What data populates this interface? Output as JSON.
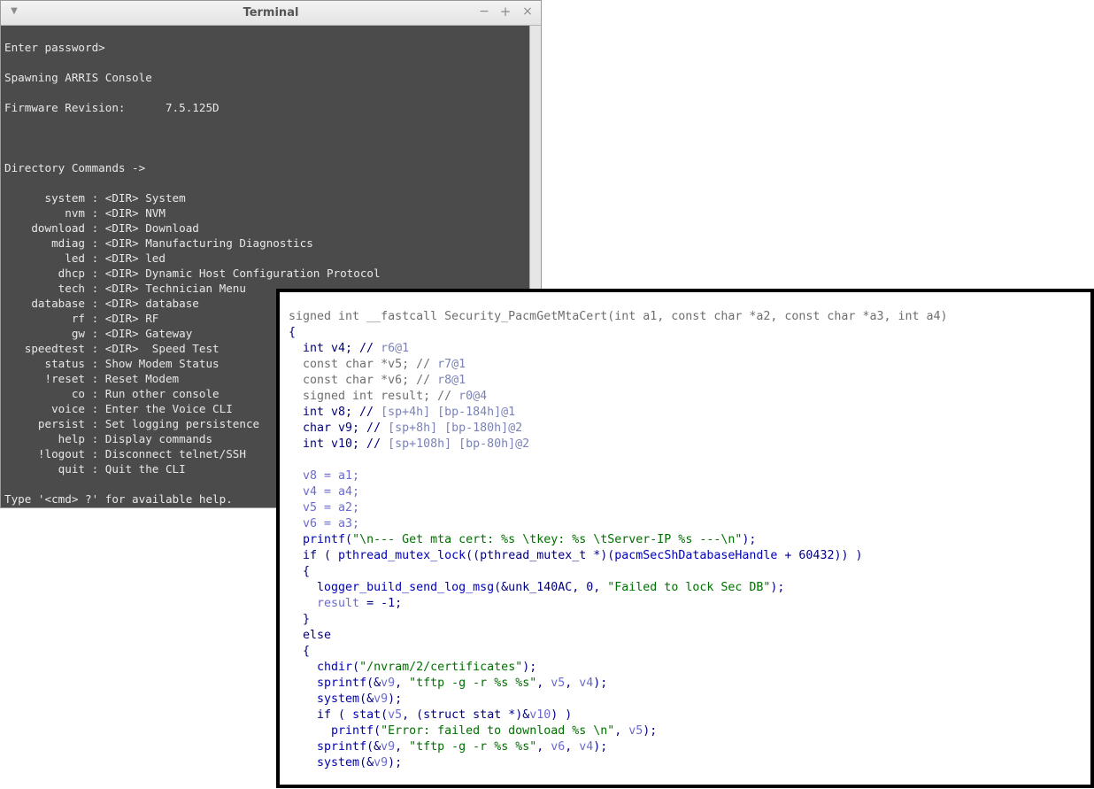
{
  "terminal": {
    "title": "Terminal",
    "menu_glyph": "▼",
    "min_glyph": "−",
    "max_glyph": "+",
    "close_glyph": "×",
    "lines": [
      "Enter password>",
      "Spawning ARRIS Console",
      "Firmware Revision:      7.5.125D",
      "Directory Commands ->",
      "      system : <DIR> System",
      "         nvm : <DIR> NVM",
      "    download : <DIR> Download",
      "       mdiag : <DIR> Manufacturing Diagnostics",
      "         led : <DIR> led",
      "        dhcp : <DIR> Dynamic Host Configuration Protocol",
      "        tech : <DIR> Technician Menu",
      "    database : <DIR> database",
      "          rf : <DIR> RF",
      "          gw : <DIR> Gateway",
      "   speedtest : <DIR>  Speed Test",
      "      status : Show Modem Status",
      "      !reset : Reset Modem",
      "          co : Run other console",
      "       voice : Enter the Voice CLI",
      "     persist : Set logging persistence",
      "        help : Display commands",
      "     !logout : Disconnect telnet/SSH",
      "        quit : Quit the CLI",
      "Type '<cmd> ?' for available help."
    ]
  },
  "code": {
    "l00": "signed int __fastcall Security_PacmGetMtaCert(int a1, const char *a2, const char *a3, int a4)",
    "l01": "{",
    "l02a": "  int v4; // ",
    "l02b": "r6@1",
    "l03a": "  const char *v5; // ",
    "l03b": "r7@1",
    "l04a": "  const char *v6; // ",
    "l04b": "r8@1",
    "l05a": "  signed int result; // ",
    "l05b": "r0@4",
    "l06a": "  int v8; // ",
    "l06b": "[sp+4h] [bp-184h]@1",
    "l07a": "  char v9; // ",
    "l07b": "[sp+8h] [bp-180h]@2",
    "l08a": "  int v10; // ",
    "l08b": "[sp+108h] [bp-80h]@2",
    "l10": "  v8 = a1;",
    "l11": "  v4 = a4;",
    "l12": "  v5 = a2;",
    "l13": "  v6 = a3;",
    "l14a": "  printf(",
    "l14b": "\"\\n--- Get mta cert: %s \\tkey: %s \\tServer-IP %s ---\\n\"",
    "l14c": ");",
    "l15a": "  if ( ",
    "l15b": "pthread_mutex_lock",
    "l15c": "((pthread_mutex_t *)(",
    "l15d": "pacmSecShDatabaseHandle",
    "l15e": " + 60432)) )",
    "l16": "  {",
    "l17a": "    ",
    "l17b": "logger_build_send_log_msg",
    "l17c": "(&unk_140AC, 0, ",
    "l17d": "\"Failed to lock Sec DB\"",
    "l17e": ");",
    "l18a": "    ",
    "l18b": "result",
    "l18c": " = -1;",
    "l19": "  }",
    "l20": "  else",
    "l21": "  {",
    "l22a": "    ",
    "l22b": "chdir",
    "l22c": "(",
    "l22d": "\"/nvram/2/certificates\"",
    "l22e": ");",
    "l23a": "    ",
    "l23b": "sprintf",
    "l23c": "(&",
    "l23d": "v9",
    "l23e": ", ",
    "l23f": "\"tftp -g -r %s %s\"",
    "l23g": ", ",
    "l23h": "v5",
    "l23i": ", ",
    "l23j": "v4",
    "l23k": ");",
    "l24a": "    ",
    "l24b": "system",
    "l24c": "(&",
    "l24d": "v9",
    "l24e": ");",
    "l25a": "    if ( ",
    "l25b": "stat",
    "l25c": "(",
    "l25d": "v5",
    "l25e": ", (struct stat *)&",
    "l25f": "v10",
    "l25g": ") )",
    "l26a": "      printf(",
    "l26b": "\"Error: failed to download %s \\n\"",
    "l26c": ", ",
    "l26d": "v5",
    "l26e": ");",
    "l27a": "    ",
    "l27b": "sprintf",
    "l27c": "(&",
    "l27d": "v9",
    "l27e": ", ",
    "l27f": "\"tftp -g -r %s %s\"",
    "l27g": ", ",
    "l27h": "v6",
    "l27i": ", ",
    "l27j": "v4",
    "l27k": ");",
    "l28a": "    ",
    "l28b": "system",
    "l28c": "(&",
    "l28d": "v9",
    "l28e": ");"
  }
}
